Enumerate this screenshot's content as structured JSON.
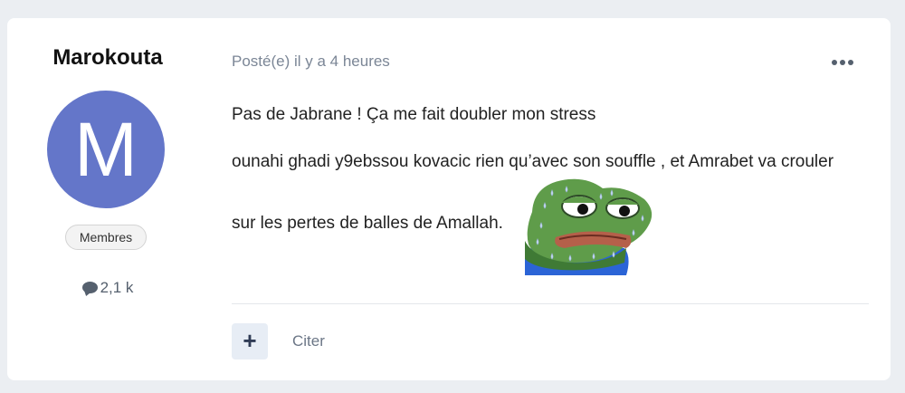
{
  "author": {
    "name": "Marokouta",
    "avatar_letter": "M",
    "avatar_color": "#6476c9",
    "group": "Membres",
    "post_count": "2,1 k"
  },
  "post": {
    "meta": "Posté(e) il y a 4 heures",
    "lines": [
      "Pas de Jabrane ! Ça me fait doubler mon stress",
      "ounahi ghadi y9ebssou kovacic rien qu’avec son souffle , et Amrabet va crouler",
      "sur les pertes de balles de Amallah."
    ],
    "emoji": "sweating-pepe-frog"
  },
  "actions": {
    "plus_label": "+",
    "quote_label": "Citer"
  }
}
